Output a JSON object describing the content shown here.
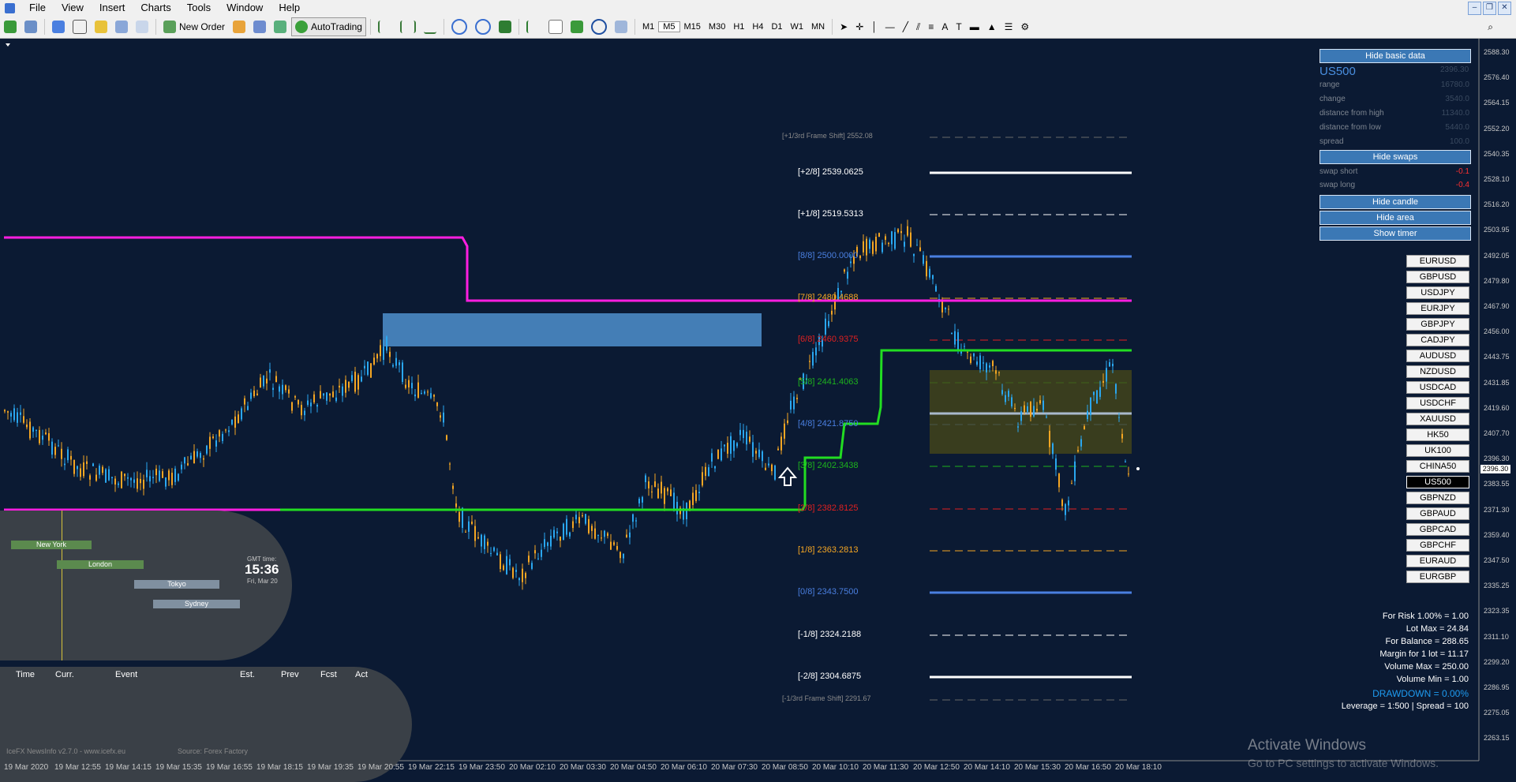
{
  "menu": {
    "items": [
      "File",
      "View",
      "Insert",
      "Charts",
      "Tools",
      "Window",
      "Help"
    ]
  },
  "toolbar": {
    "new_order_label": "New Order",
    "autotrading_label": "AutoTrading",
    "timeframes": [
      "M1",
      "M5",
      "M15",
      "M30",
      "H1",
      "H4",
      "D1",
      "W1",
      "MN"
    ],
    "active_timeframe": "M5"
  },
  "info_panel": {
    "hide_basic_data_label": "Hide basic data",
    "symbol": "US500",
    "symbol_price": "2396.30",
    "rows": [
      {
        "label": "range",
        "value": "16780.0"
      },
      {
        "label": "change",
        "value": "3540.0"
      },
      {
        "label": "distance from high",
        "value": "11340.0"
      },
      {
        "label": "distance from low",
        "value": "5440.0"
      },
      {
        "label": "spread",
        "value": "100.0"
      }
    ],
    "hide_swaps_label": "Hide swaps",
    "swap_rows": [
      {
        "label": "swap short",
        "value": "-0.1"
      },
      {
        "label": "swap long",
        "value": "-0.4"
      }
    ],
    "hide_candle_label": "Hide candle",
    "hide_area_label": "Hide area",
    "show_timer_label": "Show timer"
  },
  "symbols": [
    "EURUSD",
    "GBPUSD",
    "USDJPY",
    "EURJPY",
    "GBPJPY",
    "CADJPY",
    "AUDUSD",
    "NZDUSD",
    "USDCAD",
    "USDCHF",
    "XAUUSD",
    "HK50",
    "UK100",
    "CHINA50",
    "US500",
    "GBPNZD",
    "GBPAUD",
    "GBPCAD",
    "GBPCHF",
    "EURAUD",
    "EURGBP"
  ],
  "active_symbol": "US500",
  "murrey_math": {
    "frame_shift_top": "[+1/3rd Frame Shift]  2552.08",
    "frame_shift_bottom": "[-1/3rd Frame Shift]  2291.67",
    "levels": [
      {
        "label": "[+2/8]  2539.0625",
        "color": "#ffffff"
      },
      {
        "label": "[+1/8]  2519.5313",
        "color": "#ffffff"
      },
      {
        "label": "[8/8]  2500.0000",
        "color": "#4a7fe0"
      },
      {
        "label": "[7/8]  2480.4688",
        "color": "#f5a623"
      },
      {
        "label": "[6/8]  2460.9375",
        "color": "#e02020"
      },
      {
        "label": "[5/8]  2441.4063",
        "color": "#1db31d"
      },
      {
        "label": "[4/8]  2421.8750",
        "color": "#4a7fe0"
      },
      {
        "label": "[3/8]  2402.3438",
        "color": "#1db31d"
      },
      {
        "label": "[2/8]  2382.8125",
        "color": "#e02020"
      },
      {
        "label": "[1/8]  2363.2813",
        "color": "#f5a623"
      },
      {
        "label": "[0/8]  2343.7500",
        "color": "#4a7fe0"
      },
      {
        "label": "[-1/8]  2324.2188",
        "color": "#ffffff"
      },
      {
        "label": "[-2/8]  2304.6875",
        "color": "#ffffff"
      }
    ]
  },
  "price_axis": {
    "labels": [
      "2588.30",
      "2576.40",
      "2564.15",
      "2552.20",
      "2540.35",
      "2528.10",
      "2516.20",
      "2503.95",
      "2492.05",
      "2479.80",
      "2467.90",
      "2456.00",
      "2443.75",
      "2431.85",
      "2419.60",
      "2407.70",
      "2396.30",
      "2383.55",
      "2371.30",
      "2359.40",
      "2347.50",
      "2335.25",
      "2323.35",
      "2311.10",
      "2299.20",
      "2286.95",
      "2275.05",
      "2263.15"
    ],
    "current_price": "2396.30"
  },
  "time_axis": {
    "labels": [
      "19 Mar 2020",
      "19 Mar 12:55",
      "19 Mar 14:15",
      "19 Mar 15:35",
      "19 Mar 16:55",
      "19 Mar 18:15",
      "19 Mar 19:35",
      "19 Mar 20:55",
      "19 Mar 22:15",
      "19 Mar 23:50",
      "20 Mar 02:10",
      "20 Mar 03:30",
      "20 Mar 04:50",
      "20 Mar 06:10",
      "20 Mar 07:30",
      "20 Mar 08:50",
      "20 Mar 10:10",
      "20 Mar 11:30",
      "20 Mar 12:50",
      "20 Mar 14:10",
      "20 Mar 15:30",
      "20 Mar 16:50",
      "20 Mar 18:10"
    ]
  },
  "sessions": {
    "bars": [
      {
        "label": "New York",
        "color": "#5b8a4e"
      },
      {
        "label": "London",
        "color": "#5b8a4e"
      },
      {
        "label": "Tokyo",
        "color": "#8090a0"
      },
      {
        "label": "Sydney",
        "color": "#8090a0"
      }
    ],
    "gmt_label": "GMT time:",
    "gmt_time": "15:36",
    "gmt_date": "Fri, Mar 20"
  },
  "news": {
    "headers": [
      "Time",
      "Curr.",
      "Event",
      "Est.",
      "Prev",
      "Fcst",
      "Act"
    ],
    "footer_left": "IceFX NewsInfo v2.7.0  -  www.icefx.eu",
    "footer_right": "Source: Forex Factory"
  },
  "risk": {
    "lines": [
      "For Risk 1.00% = 1.00",
      "Lot Max = 24.84",
      "For Balance = 288.65",
      "Margin for 1 lot = 11.17",
      "Volume Max = 250.00",
      "Volume Min = 1.00"
    ],
    "drawdown": "DRAWDOWN =  0.00%",
    "leverage": "Leverage = 1:500 | Spread = 100"
  },
  "watermark": {
    "title": "Activate Windows",
    "subtitle": "Go to PC settings to activate Windows."
  },
  "colors": {
    "background": "#0b1a33",
    "bull": "#2aa7f0",
    "bear": "#f5a623",
    "magenta": "#ff1ee0",
    "green": "#22dd22"
  }
}
